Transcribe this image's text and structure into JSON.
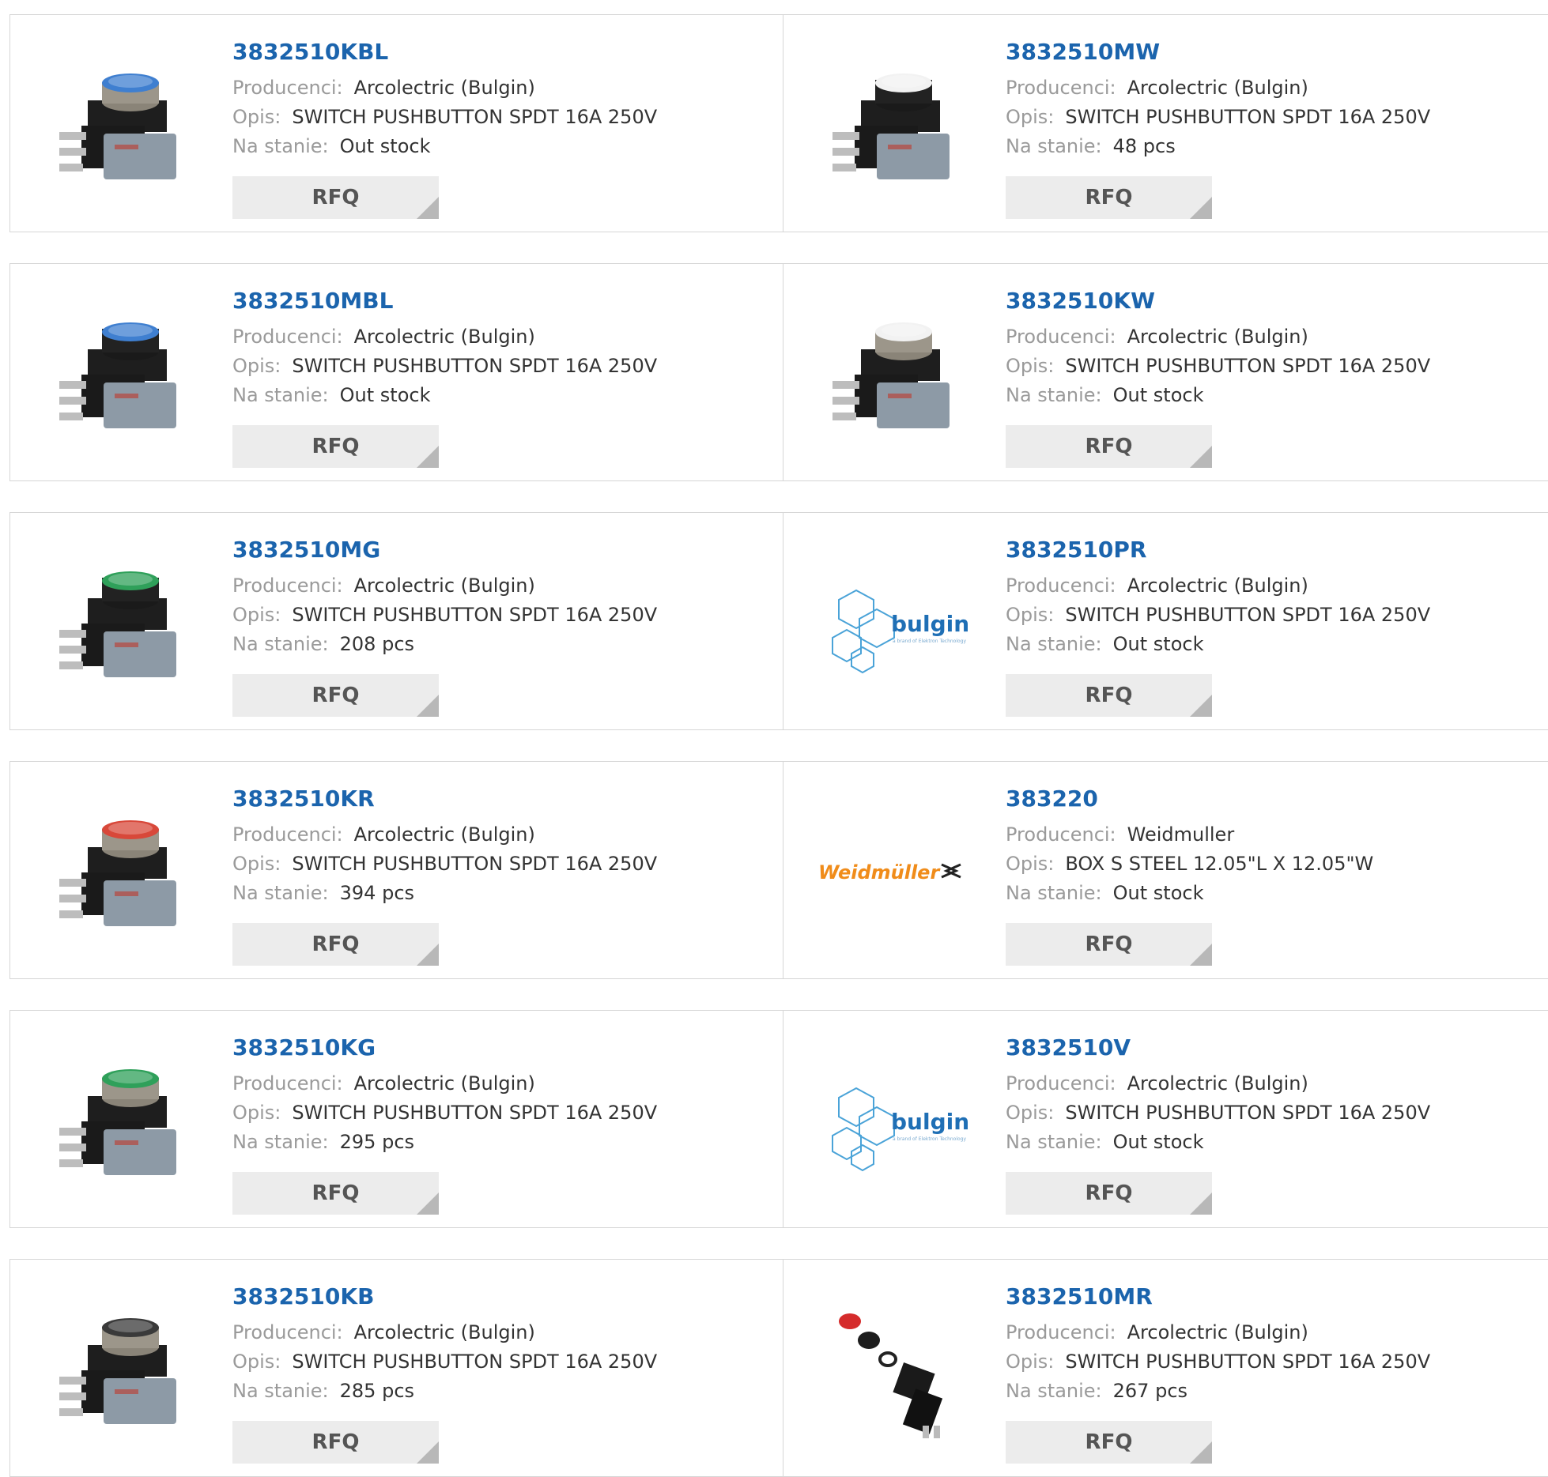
{
  "labels": {
    "manufacturer": "Producenci:",
    "description": "Opis:",
    "stock": "Na stanie:",
    "rfq": "RFQ"
  },
  "colors": {
    "link": "#1b64ad",
    "label": "#9a9a9a",
    "value": "#333333",
    "button_bg": "#ececec",
    "border": "#d6d6d6"
  },
  "products": [
    {
      "part": "3832510KBL",
      "manufacturer": "Arcolectric (Bulgin)",
      "description": "SWITCH PUSHBUTTON SPDT 16A 250V",
      "stock": "Out stock",
      "image": "switch-metal-bezel-blue-cap"
    },
    {
      "part": "3832510MW",
      "manufacturer": "Arcolectric (Bulgin)",
      "description": "SWITCH PUSHBUTTON SPDT 16A 250V",
      "stock": "48 pcs",
      "image": "switch-black-bezel-white-cap"
    },
    {
      "part": "3832510MBL",
      "manufacturer": "Arcolectric (Bulgin)",
      "description": "SWITCH PUSHBUTTON SPDT 16A 250V",
      "stock": "Out stock",
      "image": "switch-black-bezel-blue-cap"
    },
    {
      "part": "3832510KW",
      "manufacturer": "Arcolectric (Bulgin)",
      "description": "SWITCH PUSHBUTTON SPDT 16A 250V",
      "stock": "Out stock",
      "image": "switch-metal-bezel-white-cap"
    },
    {
      "part": "3832510MG",
      "manufacturer": "Arcolectric (Bulgin)",
      "description": "SWITCH PUSHBUTTON SPDT 16A 250V",
      "stock": "208 pcs",
      "image": "switch-black-bezel-green-cap"
    },
    {
      "part": "3832510PR",
      "manufacturer": "Arcolectric (Bulgin)",
      "description": "SWITCH PUSHBUTTON SPDT 16A 250V",
      "stock": "Out stock",
      "image": "bulgin-logo",
      "logo_text": "bulgin"
    },
    {
      "part": "3832510KR",
      "manufacturer": "Arcolectric (Bulgin)",
      "description": "SWITCH PUSHBUTTON SPDT 16A 250V",
      "stock": "394 pcs",
      "image": "switch-metal-bezel-red-cap"
    },
    {
      "part": "383220",
      "manufacturer": "Weidmuller",
      "description": "BOX S STEEL 12.05\"L X 12.05\"W",
      "stock": "Out stock",
      "image": "weidmuller-logo",
      "logo_text": "Weidmüller"
    },
    {
      "part": "3832510KG",
      "manufacturer": "Arcolectric (Bulgin)",
      "description": "SWITCH PUSHBUTTON SPDT 16A 250V",
      "stock": "295 pcs",
      "image": "switch-metal-bezel-green-cap"
    },
    {
      "part": "3832510V",
      "manufacturer": "Arcolectric (Bulgin)",
      "description": "SWITCH PUSHBUTTON SPDT 16A 250V",
      "stock": "Out stock",
      "image": "bulgin-logo",
      "logo_text": "bulgin"
    },
    {
      "part": "3832510KB",
      "manufacturer": "Arcolectric (Bulgin)",
      "description": "SWITCH PUSHBUTTON SPDT 16A 250V",
      "stock": "285 pcs",
      "image": "switch-metal-bezel-black-cap"
    },
    {
      "part": "3832510MR",
      "manufacturer": "Arcolectric (Bulgin)",
      "description": "SWITCH PUSHBUTTON SPDT 16A 250V",
      "stock": "267 pcs",
      "image": "switch-exploded-red-cap"
    }
  ]
}
